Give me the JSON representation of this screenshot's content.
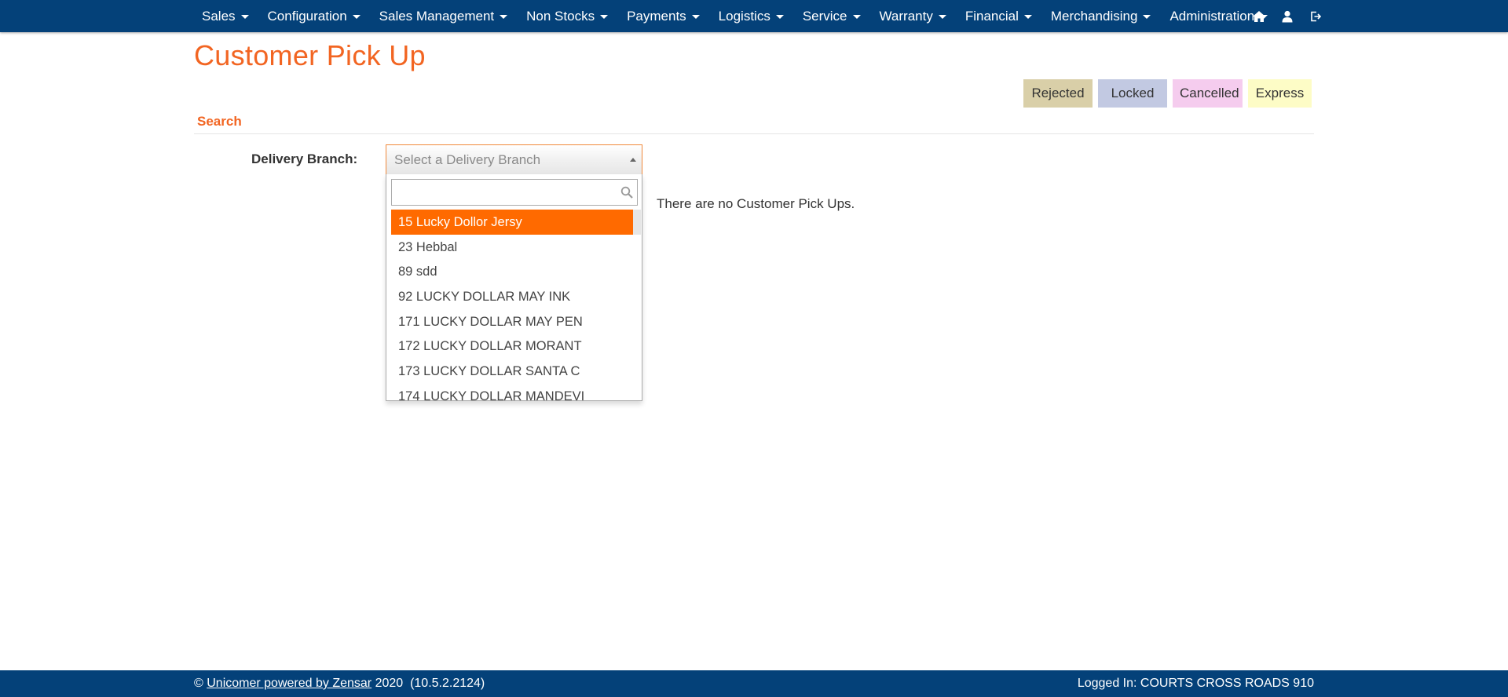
{
  "nav": {
    "items": [
      {
        "label": "Sales"
      },
      {
        "label": "Configuration"
      },
      {
        "label": "Sales Management"
      },
      {
        "label": "Non Stocks"
      },
      {
        "label": "Payments"
      },
      {
        "label": "Logistics"
      },
      {
        "label": "Service"
      },
      {
        "label": "Warranty"
      },
      {
        "label": "Financial"
      },
      {
        "label": "Merchandising"
      },
      {
        "label": "Administration"
      }
    ],
    "icons": [
      "home-icon",
      "user-icon",
      "logout-icon"
    ]
  },
  "page": {
    "title": "Customer Pick Up"
  },
  "legend": {
    "rejected": "Rejected",
    "locked": "Locked",
    "cancelled": "Cancelled",
    "express": "Express"
  },
  "search": {
    "section_title": "Search",
    "delivery_branch_label": "Delivery Branch:",
    "select_placeholder": "Select a Delivery Branch",
    "search_value": "",
    "options": [
      "15 Lucky Dollor Jersy",
      "23 Hebbal",
      "89 sdd",
      "92 LUCKY DOLLAR MAY INK",
      "171 LUCKY DOLLAR MAY PEN",
      "172 LUCKY DOLLAR MORANT",
      "173 LUCKY DOLLAR SANTA C",
      "174 LUCKY DOLLAR MANDEVI"
    ],
    "highlighted_option": "15 Lucky Dollor Jersy"
  },
  "results": {
    "empty_message": "There are no Customer Pick Ups."
  },
  "footer": {
    "copyright_symbol": "©",
    "company_link": "Unicomer powered by Zensar",
    "year": "2020",
    "version": "(10.5.2.2124)",
    "logged_in": "Logged In: COURTS CROSS ROADS 910"
  },
  "colors": {
    "navbar": "#044179",
    "accent": "#f26522",
    "highlight": "#ff6a00",
    "rejected": "#d9cfa8",
    "locked": "#c2c9e2",
    "cancelled": "#f5ccee",
    "express": "#fdfcc6"
  }
}
